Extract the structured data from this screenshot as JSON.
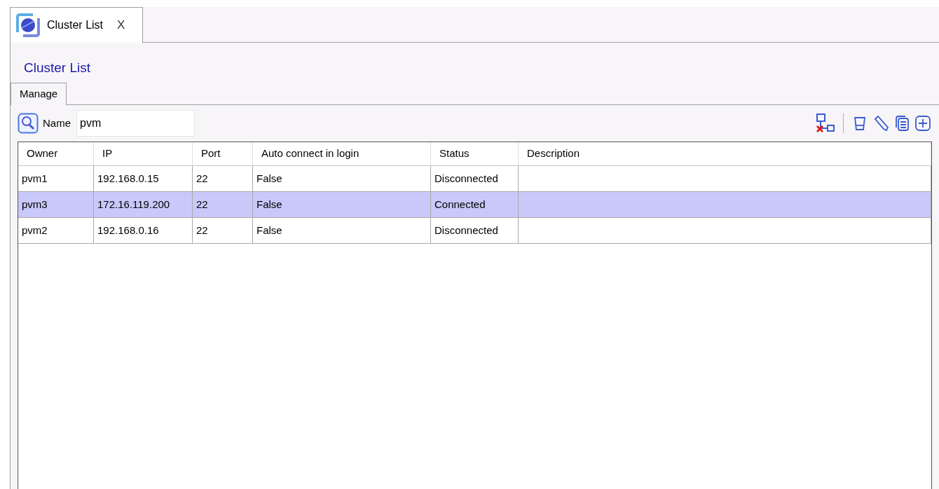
{
  "doc_tab": {
    "label": "Cluster List",
    "close": "X",
    "selected": true
  },
  "title": "Cluster List",
  "tabs": [
    {
      "label": "Manage",
      "selected": true
    }
  ],
  "search": {
    "label": "Name",
    "value": "pvm"
  },
  "table": {
    "columns": [
      "Owner",
      "IP",
      "Port",
      "Auto connect in login",
      "Status",
      "Description"
    ],
    "rows": [
      {
        "cells": [
          "pvm1",
          "192.168.0.15",
          "22",
          "False",
          "Disconnected",
          ""
        ],
        "selected": false
      },
      {
        "cells": [
          "pvm3",
          "172.16.119.200",
          "22",
          "False",
          "Connected",
          ""
        ],
        "selected": true
      },
      {
        "cells": [
          "pvm2",
          "192.168.0.16",
          "22",
          "False",
          "Disconnected",
          ""
        ],
        "selected": false
      }
    ]
  }
}
